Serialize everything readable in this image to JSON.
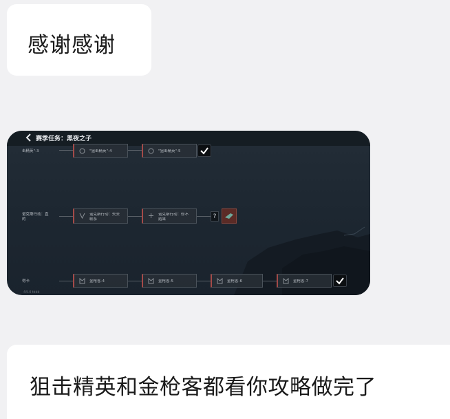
{
  "messages": {
    "top": "感谢感谢",
    "bottom": "狙击精英和金枪客都看你攻略做完了"
  },
  "screenshot": {
    "title": "赛季任务：黑夜之子",
    "row1": {
      "partial": "击精英\"-3",
      "nodes": [
        "\"狙击精英\"-4",
        "\"狙击精英\"-5"
      ]
    },
    "row2": {
      "partial_line1": "诺克斯行动：直",
      "partial_line2": "的",
      "nodes": [
        {
          "line1": "诺克斯行动：失去",
          "line2": "联系"
        },
        {
          "line1": "诺克斯行动：修不",
          "line2": "结果"
        }
      ],
      "mystery": "?"
    },
    "row3": {
      "partial": "得卡",
      "nodes": [
        "金枪客-4",
        "金枪客-5",
        "金枪客-6",
        "金枪客-7"
      ]
    },
    "bottom_strip": "44.4 tkkk"
  },
  "colors": {
    "background": "#f1f1f3",
    "bubble": "#ffffff",
    "game_accent": "#a44a48"
  }
}
